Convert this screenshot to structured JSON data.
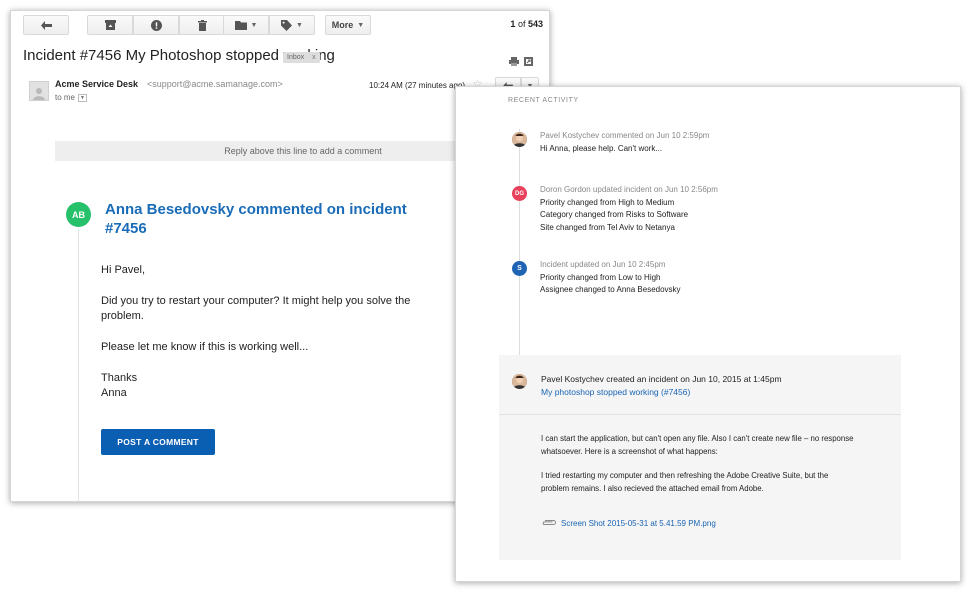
{
  "email": {
    "toolbar": {
      "more_label": "More",
      "pager_current": "1",
      "pager_of": "of",
      "pager_total": "543"
    },
    "subject": "Incident #7456 My Photoshop stopped working",
    "inbox_tag": "Inbox",
    "inbox_tag_close": "x",
    "sender_name": "Acme Service Desk",
    "sender_email": "<support@acme.samanage.com>",
    "to_me": "to me",
    "timestamp": "10:24 AM (27 minutes ago)",
    "reply_line": "Reply above this line to add a comment",
    "avatar_initials": "AB",
    "comment_heading": "Anna Besedovsky commented on incident #7456",
    "body": [
      "Hi Pavel,",
      "Did you try to restart your computer? It might help you solve the problem.",
      "Please let me know if this is working well...",
      "Thanks\nAnna"
    ],
    "post_button": "POST A COMMENT"
  },
  "activity": {
    "title": "RECENT ACTIVITY",
    "items": [
      {
        "initials": "",
        "meta": "Pavel Kostychev commented on Jun 10 2:59pm",
        "lines": [
          "Hi Anna, please help. Can't work..."
        ]
      },
      {
        "initials": "DG",
        "meta": "Doron Gordon updated incident on Jun 10 2:56pm",
        "lines": [
          "Priority changed from High to Medium",
          "Category changed from Risks to Software",
          "Site changed from Tel Aviv to Netanya"
        ]
      },
      {
        "initials": "S",
        "meta": "Incident updated on Jun 10 2:45pm",
        "lines": [
          "Priority changed from Low to High",
          "Assignee changed to Anna Besedovsky"
        ]
      }
    ],
    "created": {
      "headline": "Pavel Kostychev created an incident on Jun 10, 2015 at 1:45pm",
      "link": "My photoshop stopped working (#7456)",
      "body": [
        "I can start the application, but can't open any file. Also I can't create new file – no response whatsoever. Here is a screenshot of what happens:",
        "I tried restarting my computer and then refreshing the Adobe Creative Suite, but the problem remains. I also recieved the attached email from Adobe."
      ],
      "attachment": "Screen Shot 2015-05-31 at 5.41.59 PM.png"
    }
  },
  "colors": {
    "accent_blue": "#1a6cb8",
    "button_blue": "#0b5fb3",
    "badge_green": "#27c06b",
    "badge_red": "#e9415b",
    "badge_blue": "#1f64b4"
  }
}
